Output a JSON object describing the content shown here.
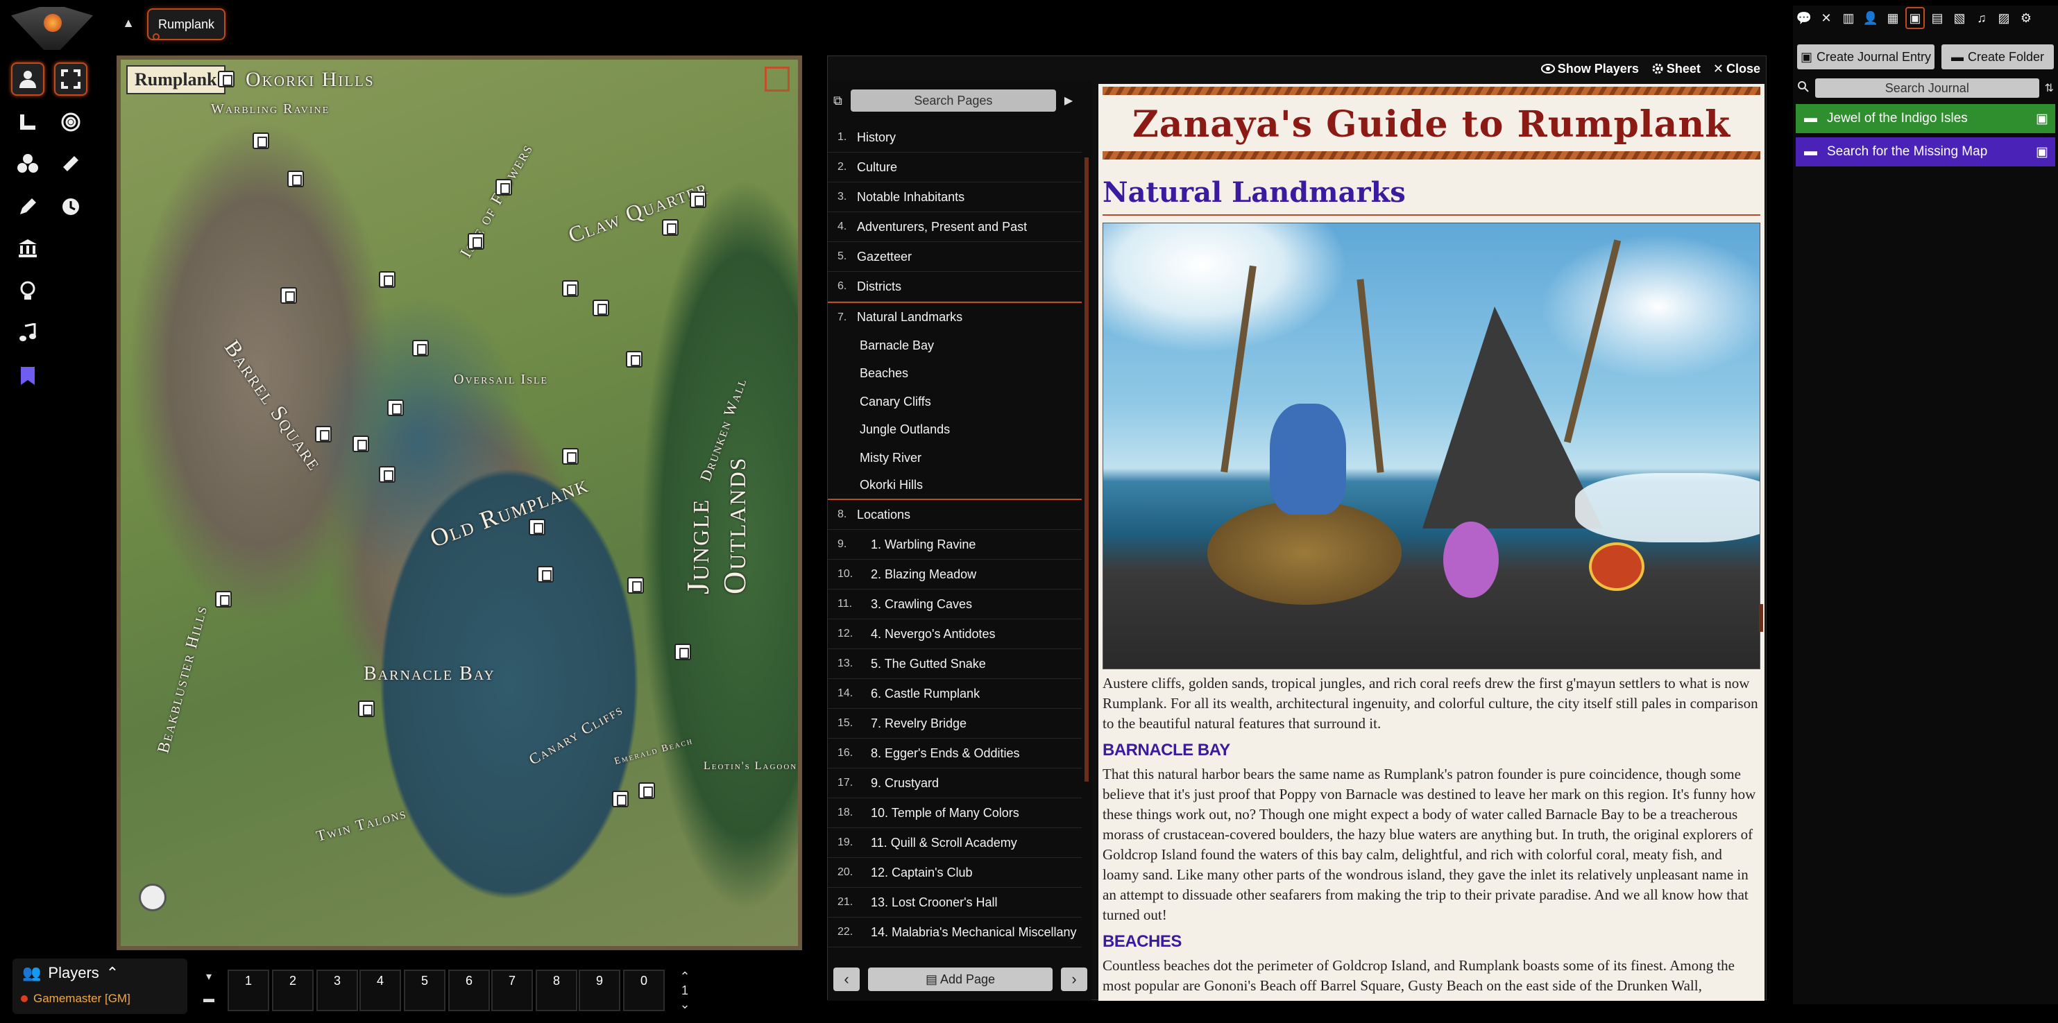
{
  "scene": {
    "tab_label": "Rumplank"
  },
  "controls": [
    "token-controls",
    "fullscreen-icon",
    "measure-icon",
    "target-icon",
    "tiles-icon",
    "ruler-icon",
    "draw-icon",
    "clock-icon",
    "walls-icon",
    "light-icon",
    "sound-icon",
    "notes-icon"
  ],
  "map": {
    "title": "Rumplank",
    "labels": [
      {
        "text": "Okorki Hills",
        "name": "okorki-hills"
      },
      {
        "text": "Warbling Ravine",
        "name": "warbling-ravine"
      },
      {
        "text": "Isle of Flowers",
        "name": "isle-of-flowers"
      },
      {
        "text": "Claw Quarter",
        "name": "claw-quarter"
      },
      {
        "text": "Barrel Square",
        "name": "barrel-square"
      },
      {
        "text": "Oversail Isle",
        "name": "oversail-isle"
      },
      {
        "text": "Old Rumplank",
        "name": "old-rumplank"
      },
      {
        "text": "Drunken Wall",
        "name": "drunken-wall"
      },
      {
        "text": "Jungle Outlands",
        "name": "jungle-outlands"
      },
      {
        "text": "Barnacle Bay",
        "name": "barnacle-bay"
      },
      {
        "text": "Beakbluster Hills",
        "name": "beakbluster-hills"
      },
      {
        "text": "Canary Cliffs",
        "name": "canary-cliffs"
      },
      {
        "text": "Twin Talons",
        "name": "twin-talons"
      },
      {
        "text": "Emerald Beach",
        "name": "emerald-beach"
      },
      {
        "text": "Leotin's Lagoon",
        "name": "leotins-lagoon"
      }
    ]
  },
  "journal": {
    "header": {
      "show_players": "Show Players",
      "sheet": "Sheet",
      "close": "Close"
    },
    "search_placeholder": "Search Pages",
    "pages": [
      {
        "n": "1.",
        "label": "History"
      },
      {
        "n": "2.",
        "label": "Culture"
      },
      {
        "n": "3.",
        "label": "Notable Inhabitants"
      },
      {
        "n": "4.",
        "label": "Adventurers, Present and Past"
      },
      {
        "n": "5.",
        "label": "Gazetteer"
      },
      {
        "n": "6.",
        "label": "Districts"
      },
      {
        "n": "7.",
        "label": "Natural Landmarks"
      }
    ],
    "subpages": [
      "Barnacle Bay",
      "Beaches",
      "Canary Cliffs",
      "Jungle Outlands",
      "Misty River",
      "Okorki Hills"
    ],
    "pages2": [
      {
        "n": "8.",
        "label": "Locations"
      },
      {
        "n": "9.",
        "label": "1. Warbling Ravine"
      },
      {
        "n": "10.",
        "label": "2. Blazing Meadow"
      },
      {
        "n": "11.",
        "label": "3. Crawling Caves"
      },
      {
        "n": "12.",
        "label": "4. Nevergo's Antidotes"
      },
      {
        "n": "13.",
        "label": "5. The Gutted Snake"
      },
      {
        "n": "14.",
        "label": "6. Castle Rumplank"
      },
      {
        "n": "15.",
        "label": "7. Revelry Bridge"
      },
      {
        "n": "16.",
        "label": "8. Egger's Ends & Oddities"
      },
      {
        "n": "17.",
        "label": "9. Crustyard"
      },
      {
        "n": "18.",
        "label": "10. Temple of Many Colors"
      },
      {
        "n": "19.",
        "label": "11. Quill & Scroll Academy"
      },
      {
        "n": "20.",
        "label": "12. Captain's Club"
      },
      {
        "n": "21.",
        "label": "13. Lost Crooner's Hall"
      },
      {
        "n": "22.",
        "label": "14. Malabria's Mechanical Miscellany"
      }
    ],
    "add_page": "Add Page",
    "page": {
      "title": "Zanaya's Guide to Rumplank",
      "heading": "Natural Landmarks",
      "intro": "Austere cliffs, golden sands, tropical jungles, and rich coral reefs drew the first g'mayun settlers to what is now Rumplank. For all its wealth, architectural ingenuity, and colorful culture, the city itself still pales in comparison to the beautiful natural features that surround it.",
      "sec1_title": "BARNACLE BAY",
      "sec1_text": "That this natural harbor bears the same name as Rumplank's patron founder is pure coincidence, though some believe that it's just proof that Poppy von Barnacle was destined to leave her mark on this region. It's funny how these things work out, no? Though one might expect a body of water called Barnacle Bay to be a treacherous morass of crustacean-covered boulders, the hazy blue waters are anything but. In truth, the original explorers of Goldcrop Island found the waters of this bay calm, delightful, and rich with colorful coral, meaty fish, and loamy sand. Like many other parts of the wondrous island, they gave the inlet its relatively unpleasant name in an attempt to dissuade other seafarers from making the trip to their private paradise. And we all know how that turned out!",
      "sec2_title": "BEACHES",
      "sec2_text": "Countless beaches dot the perimeter of Goldcrop Island, and Rumplank boasts some of its finest. Among the most popular are Gononi's Beach off Barrel Square, Gusty Beach on the east side of the Drunken Wall,"
    }
  },
  "sidebar": {
    "create_entry": "Create Journal Entry",
    "create_folder": "Create Folder",
    "search_placeholder": "Search Journal",
    "folders": [
      {
        "label": "Jewel of the Indigo Isles",
        "color": "#2f8f2f"
      },
      {
        "label": "Search for the Missing Map",
        "color": "#4a22b8"
      }
    ]
  },
  "players": {
    "title": "Players",
    "gm": "Gamemaster [GM]"
  },
  "hotbar": {
    "slots": [
      "1",
      "2",
      "3",
      "4",
      "5",
      "6",
      "7",
      "8",
      "9",
      "0"
    ],
    "page": "1"
  },
  "colors": {
    "accent": "#c04a1c",
    "heading": "#3a1a9e",
    "title": "#8b1a14"
  }
}
